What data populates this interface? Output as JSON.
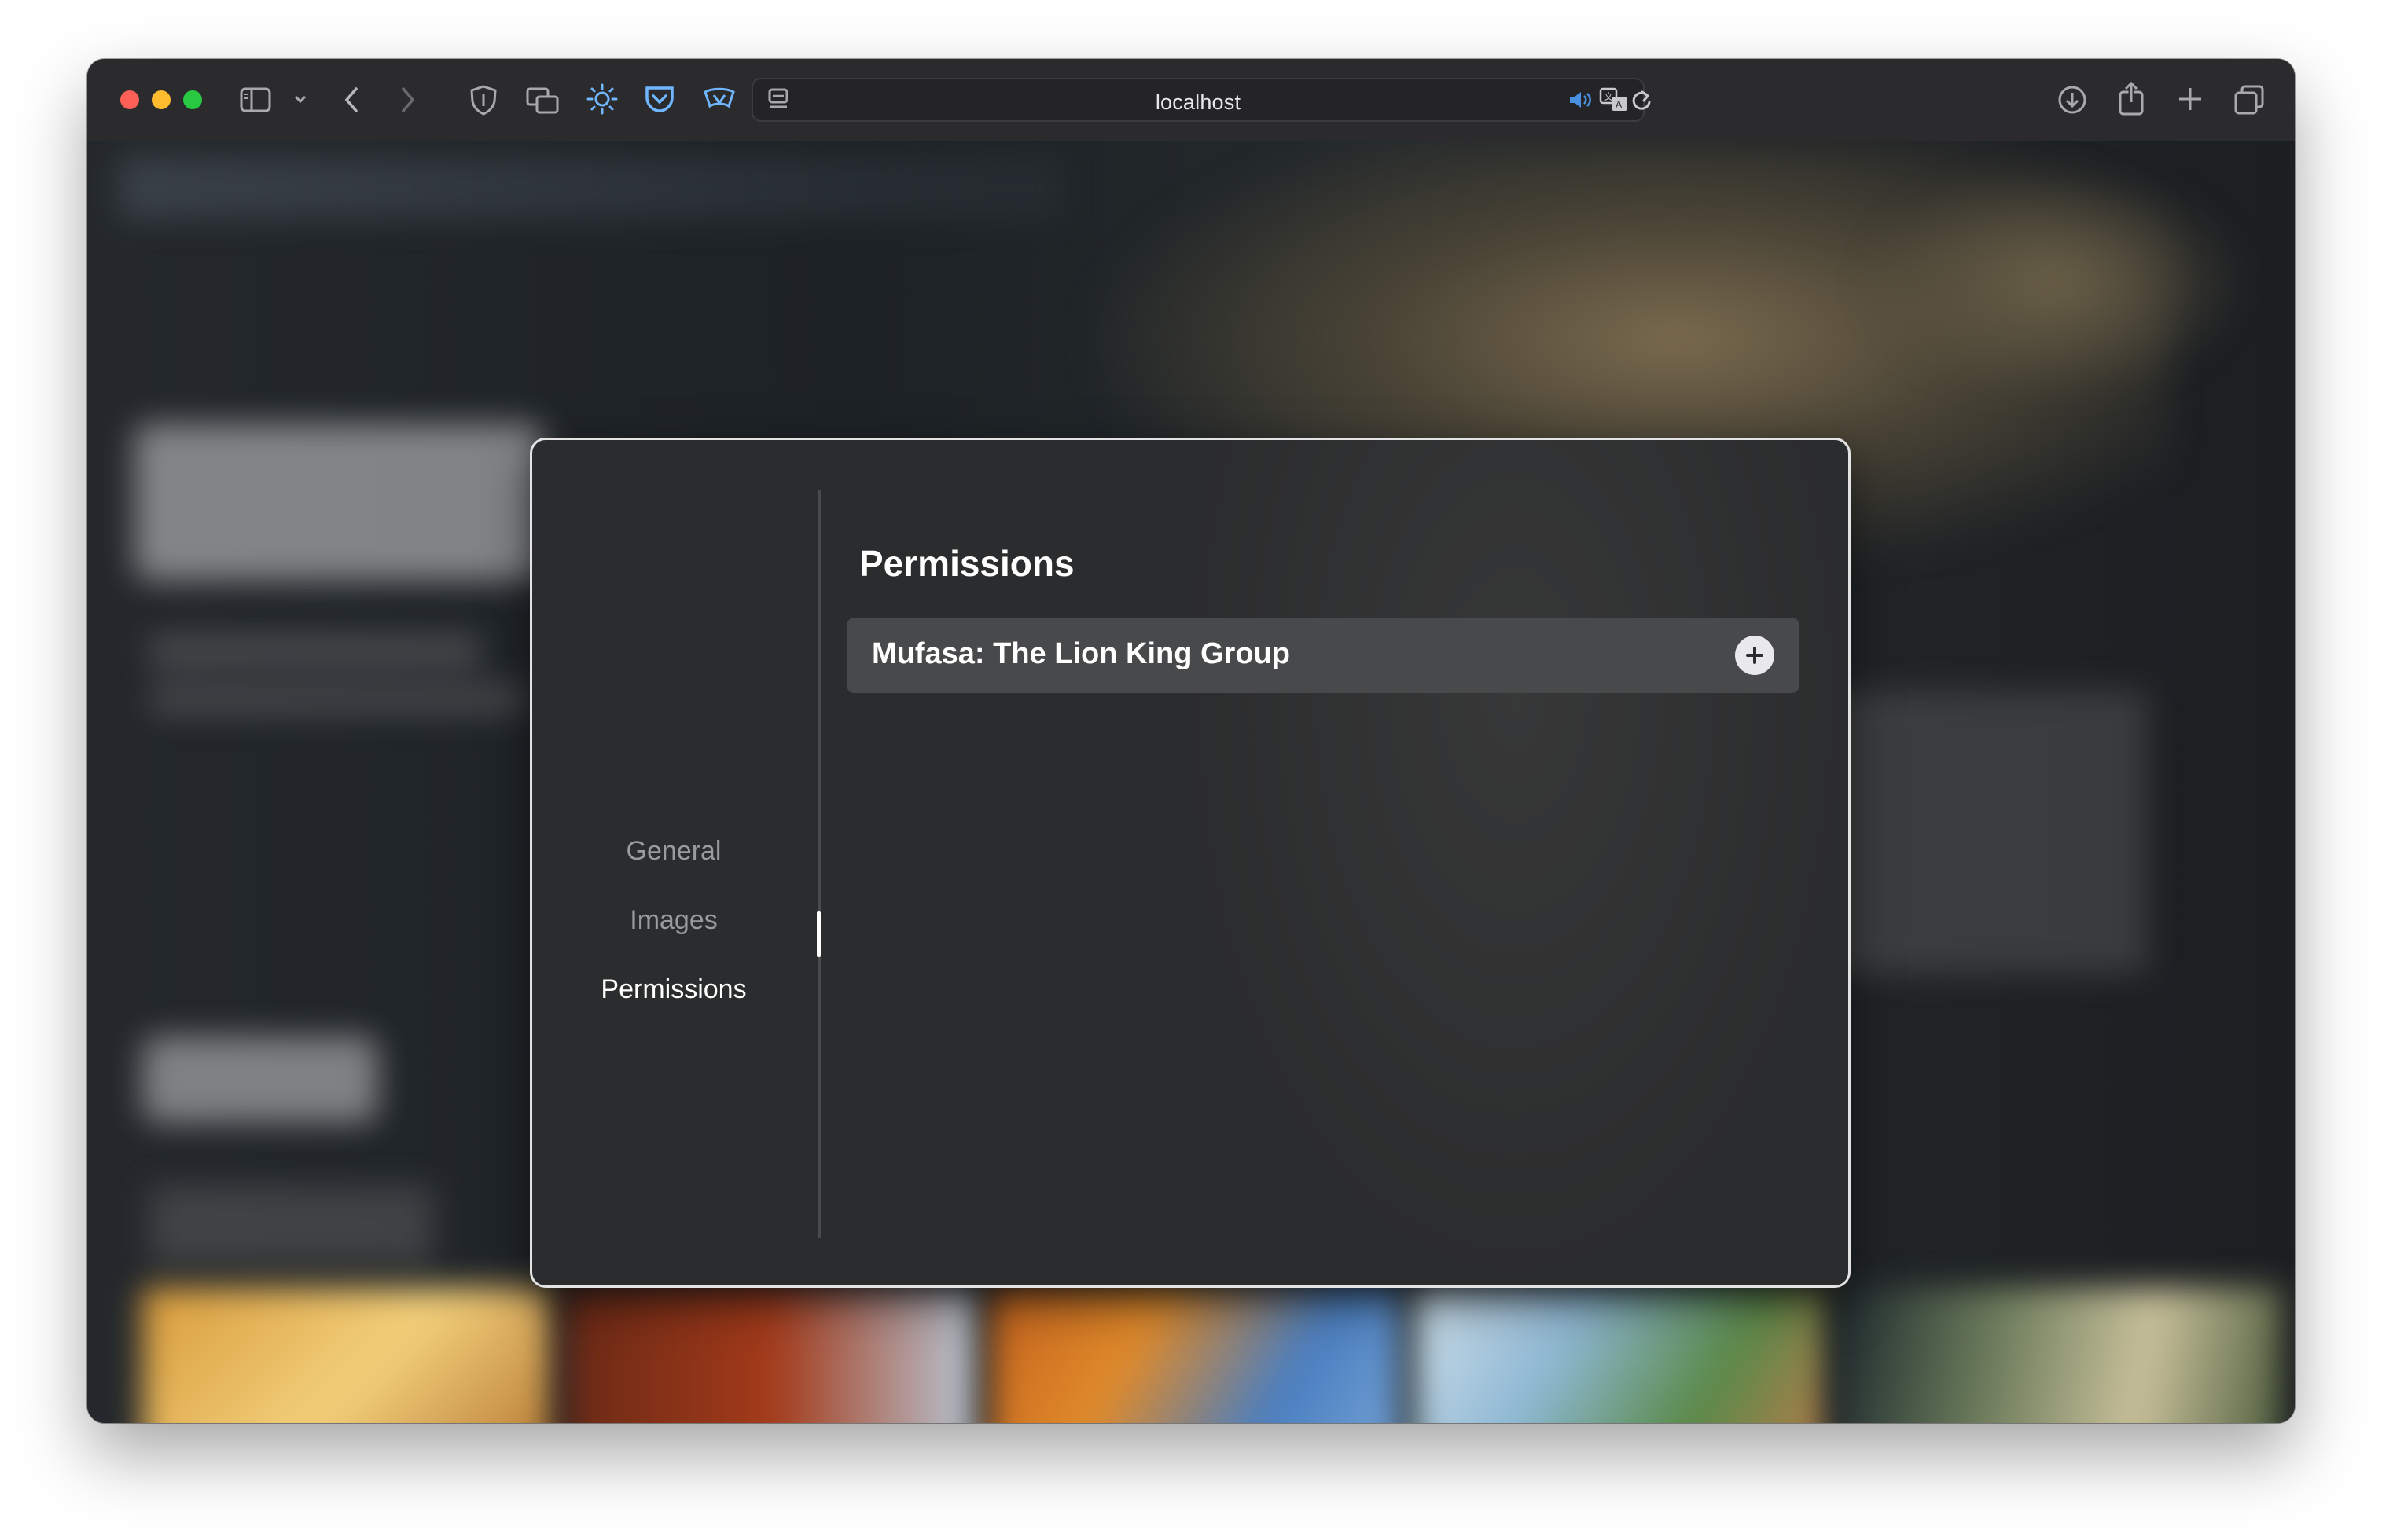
{
  "browser": {
    "url": "localhost",
    "traffic_lights": [
      "close",
      "minimize",
      "zoom"
    ],
    "left_icons": [
      "sidebar-icon",
      "chevron-down-icon",
      "back-icon",
      "forward-icon"
    ],
    "extension_icons": [
      "shield-icon",
      "tabs-icon",
      "sun-icon",
      "pocket-icon",
      "extension-icon",
      "reader-icon"
    ],
    "address_icons": [
      "speaker-icon",
      "translate-icon",
      "reload-icon"
    ],
    "right_icons": [
      "download-icon",
      "share-icon",
      "plus-icon",
      "tabs-overview-icon"
    ]
  },
  "modal": {
    "nav": {
      "items": [
        {
          "label": "General",
          "active": false
        },
        {
          "label": "Images",
          "active": false
        },
        {
          "label": "Permissions",
          "active": true
        }
      ]
    },
    "section_title": "Permissions",
    "permissions": [
      {
        "label": "Mufasa: The Lion King Group",
        "action_icon": "plus-circle-icon"
      }
    ]
  },
  "colors": {
    "accent_blue": "#4a90e2",
    "modal_bg": "#2b2c2d",
    "row_bg": "#48494b"
  }
}
